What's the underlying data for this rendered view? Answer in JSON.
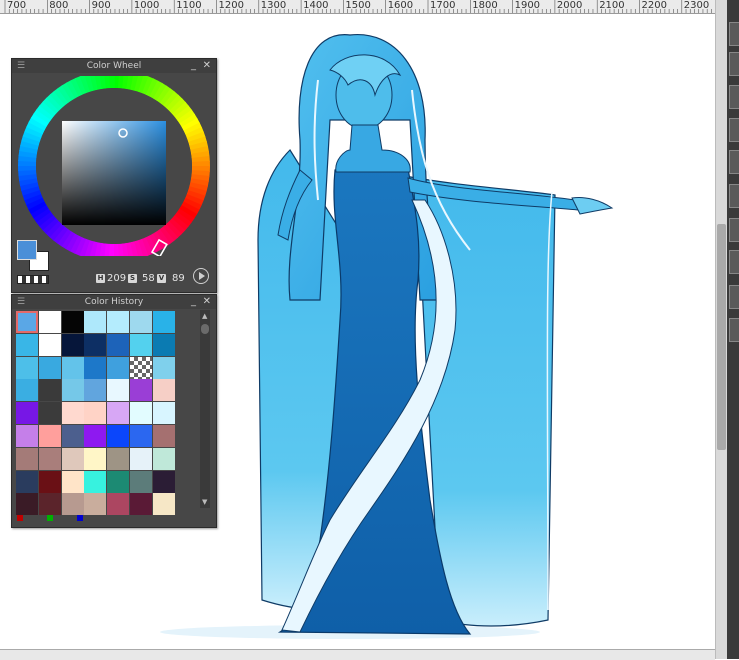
{
  "ruler": {
    "labels": [
      "700",
      "800",
      "900",
      "1000",
      "1100",
      "1200",
      "1300",
      "1400",
      "1500",
      "1600",
      "1700",
      "1800",
      "1900",
      "2000",
      "2100",
      "2200",
      "2300"
    ]
  },
  "color_wheel": {
    "title": "Color Wheel",
    "minimize_glyph": "_",
    "close_glyph": "✕",
    "hue_color": "#2b8fe0",
    "foreground_color": "#4a8fd8",
    "background_color": "#ffffff",
    "hsv": {
      "h_label": "H",
      "h": "209",
      "s_label": "S",
      "s": "58",
      "v_label": "V",
      "v": "89"
    }
  },
  "color_history": {
    "title": "Color History",
    "minimize_glyph": "_",
    "close_glyph": "✕",
    "swatches": [
      [
        "#5aa7e6",
        "#ffffff",
        "#050505",
        "#aee8fb",
        "#b4ecfd",
        "#9ed9ee",
        "#29b2e8"
      ],
      [
        "#39b6e7",
        "#ffffff",
        "#06163a",
        "#0d2f64",
        "#1d63b9",
        "#53d1ee",
        "#0b7bb2"
      ],
      [
        "#4dbfe9",
        "#39a9e0",
        "#63c3ea",
        "#1d78c9",
        "#3fa0de",
        "#checker",
        "#7fd0ec"
      ],
      [
        "#3aaee2",
        "#3a3a3a",
        "#75c8e8",
        "#61a5de",
        "#e8f8ff",
        "#9a3ed6",
        "#f6cfc6"
      ],
      [
        "#7717e6",
        "#3b3b3b",
        "#ffd9cf",
        "#ffd3c6",
        "#d7a7f5",
        "#e2fcff",
        "#d8f5ff"
      ],
      [
        "#c57fe9",
        "#ff9f9c",
        "#4c5f8e",
        "#8e19f0",
        "#0b46fb",
        "#2b67f0",
        "#a57070"
      ],
      [
        "#a47b78",
        "#a97e7b",
        "#dfc8bb",
        "#fff6c7",
        "#9e9485",
        "#e6f2f9",
        "#bfe8d9"
      ],
      [
        "#2a3c5e",
        "#6a1015",
        "#ffe4c8",
        "#37f2df",
        "#1c8a73",
        "#5c7c7a",
        "#2b1d35"
      ],
      [
        "#3a1b26",
        "#5b242b",
        "#b79a90",
        "#c9ad9d",
        "#ac4661",
        "#5a1a36",
        "#f6e7c6"
      ]
    ],
    "recent_markers": [
      "#c00000",
      "#00b000",
      "#0000d0"
    ]
  }
}
